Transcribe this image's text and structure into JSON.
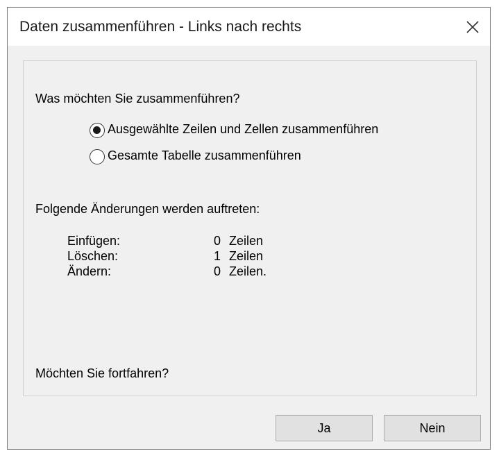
{
  "dialog": {
    "title": "Daten zusammenführen - Links nach rechts",
    "close_icon": "close-icon"
  },
  "question": "Was möchten Sie zusammenführen?",
  "options": [
    {
      "label": "Ausgewählte Zeilen und Zellen zusammenführen",
      "checked": true
    },
    {
      "label": "Gesamte Tabelle zusammenführen",
      "checked": false
    }
  ],
  "changes_heading": "Folgende Änderungen werden auftreten:",
  "changes": [
    {
      "label": "Einfügen:",
      "count": "0",
      "unit": "Zeilen"
    },
    {
      "label": "Löschen:",
      "count": "1",
      "unit": "Zeilen"
    },
    {
      "label": "Ändern:",
      "count": "0",
      "unit": "Zeilen."
    }
  ],
  "confirm_question": "Möchten Sie fortfahren?",
  "buttons": {
    "yes": "Ja",
    "no": "Nein"
  }
}
